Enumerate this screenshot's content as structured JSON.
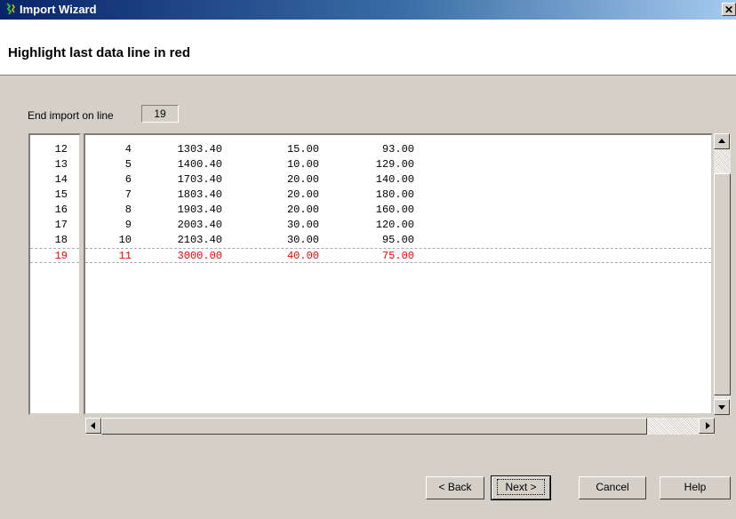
{
  "window": {
    "title": "Import Wizard",
    "close_glyph": "✕"
  },
  "header": {
    "heading": "Highlight last data line in red"
  },
  "end_import": {
    "label": "End import on line",
    "value": "19"
  },
  "line_numbers": [
    "12",
    "13",
    "14",
    "15",
    "16",
    "17",
    "18",
    "19"
  ],
  "rows": [
    [
      "4",
      "1303.40",
      "15.00",
      "93.00"
    ],
    [
      "5",
      "1400.40",
      "10.00",
      "129.00"
    ],
    [
      "6",
      "1703.40",
      "20.00",
      "140.00"
    ],
    [
      "7",
      "1803.40",
      "20.00",
      "180.00"
    ],
    [
      "8",
      "1903.40",
      "20.00",
      "160.00"
    ],
    [
      "9",
      "2003.40",
      "30.00",
      "120.00"
    ],
    [
      "10",
      "2103.40",
      "30.00",
      "95.00"
    ],
    [
      "11",
      "3000.00",
      "40.00",
      "75.00"
    ]
  ],
  "highlight_index": 7,
  "highlight_color": "#ff0000",
  "buttons": {
    "back": "< Back",
    "next": "Next >",
    "cancel": "Cancel",
    "help": "Help"
  }
}
